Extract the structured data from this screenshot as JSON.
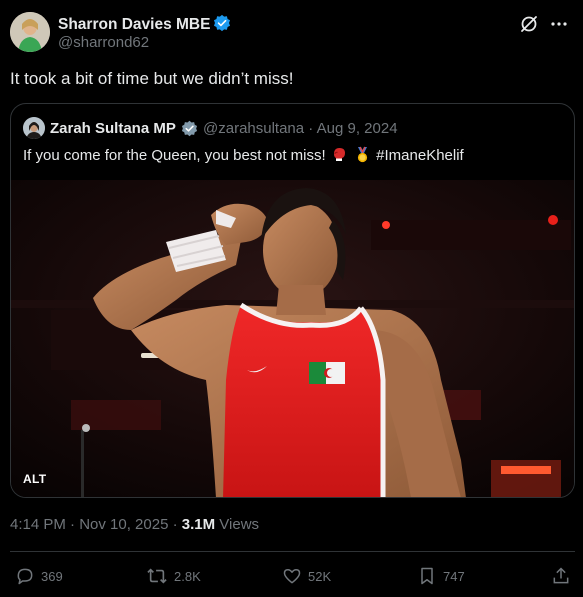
{
  "post": {
    "author_name": "Sharron Davies MBE",
    "author_handle": "@sharrond62",
    "text": "It took a bit of time but we didn’t miss!",
    "timestamp": "4:14 PM · Nov 10, 2025 · ",
    "views_count": "3.1M",
    "views_label": " Views"
  },
  "quote": {
    "author_name": "Zarah Sultana MP",
    "author_handle": "@zarahsultana",
    "date": "Aug 9, 2024",
    "meta_separator": " · ",
    "text": "If you come for the Queen, you best not miss!",
    "hashtag": "#ImaneKhelif",
    "emojis": [
      "boxing-glove",
      "gold-medal"
    ],
    "media_alt_badge": "ALT"
  },
  "actions": {
    "replies": "369",
    "reposts": "2.8K",
    "likes": "52K",
    "bookmarks": "747"
  },
  "colors": {
    "background": "#000000",
    "text_primary": "#e7e9ea",
    "text_secondary": "#71767b",
    "border": "#2f3336",
    "verified_blue": "#1d9bf0",
    "verified_gray": "#829aab"
  }
}
